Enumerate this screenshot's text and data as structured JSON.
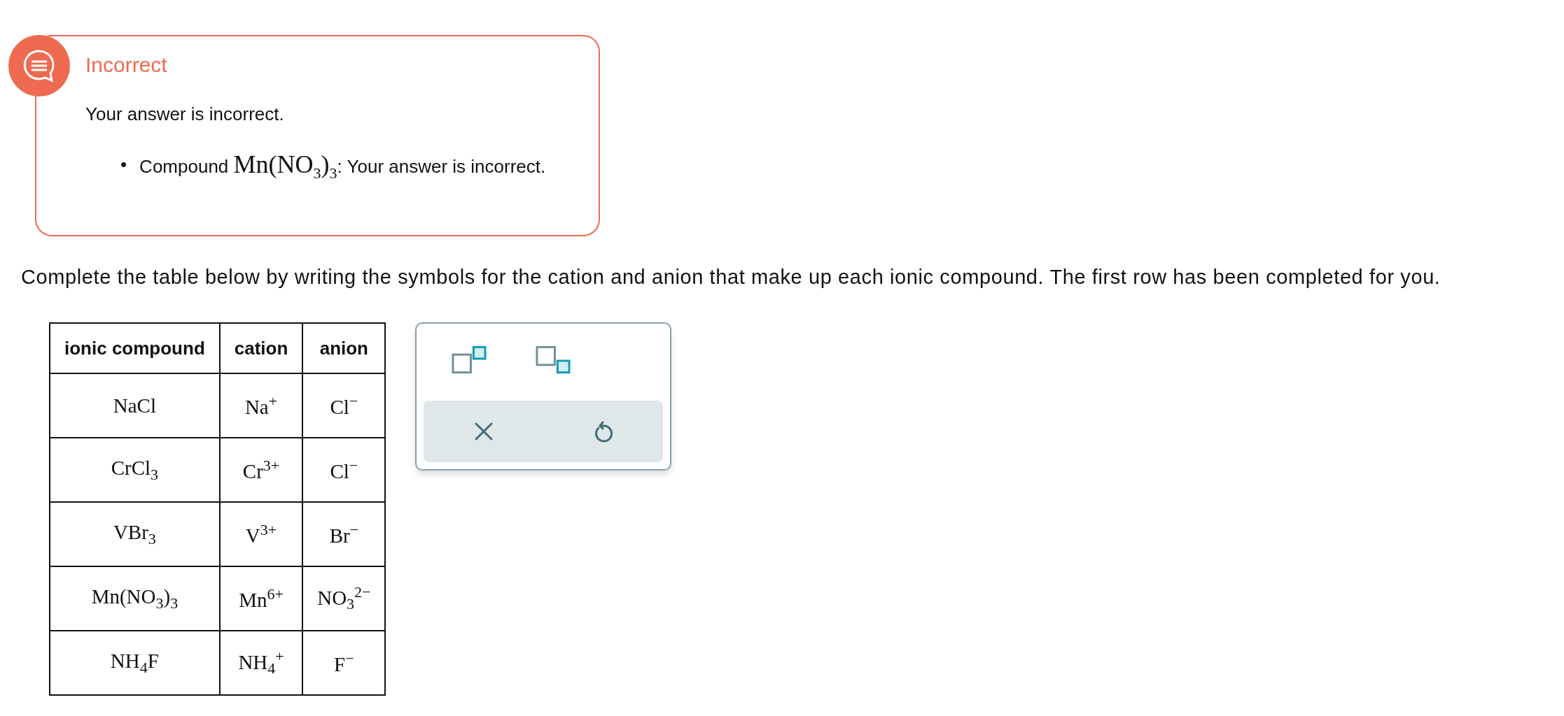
{
  "feedback": {
    "title": "Incorrect",
    "message": "Your answer is incorrect.",
    "items": [
      {
        "bullet": "•",
        "label": "Compound",
        "formula": "Mn(NO$_{3}$)$_{3}$",
        "result": ": Your answer is incorrect."
      }
    ]
  },
  "instruction": "Complete the table below by writing the symbols for the cation and anion that make up each ionic compound. The first row has been completed for you.",
  "table": {
    "columns": [
      "ionic compound",
      "cation",
      "anion"
    ],
    "rows": [
      [
        "NaCl",
        "Na$^{+}$",
        "Cl$^{−}$"
      ],
      [
        "CrCl$_{3}$",
        "Cr$^{3+}$",
        "Cl$^{−}$"
      ],
      [
        "VBr$_{3}$",
        "V$^{3+}$",
        "Br$^{−}$"
      ],
      [
        "Mn(NO$_{3}$)$_{3}$",
        "Mn$^{6+}$",
        "NO$_{3}$$^{2−}$"
      ],
      [
        "NH$_{4}$F",
        "NH$_{4}$$^{+}$",
        "F$^{−}$"
      ]
    ]
  },
  "palette": {
    "format_buttons": [
      {
        "kind": "superscript"
      },
      {
        "kind": "subscript"
      }
    ],
    "action_buttons": [
      {
        "kind": "clear"
      },
      {
        "kind": "undo"
      }
    ]
  }
}
